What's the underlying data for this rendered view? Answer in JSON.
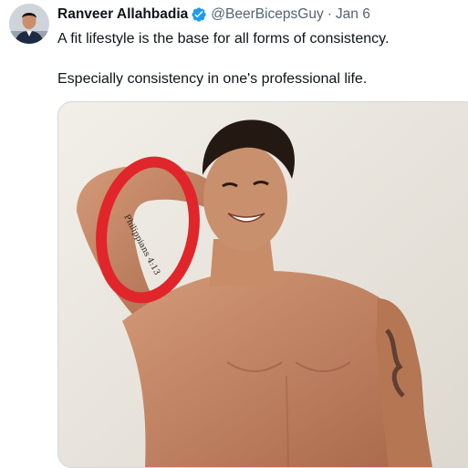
{
  "tweet": {
    "author": {
      "display_name": "Ranveer Allahbadia",
      "handle": "@BeerBicepsGuy",
      "verified": true,
      "avatar_icon": "profile-photo"
    },
    "separator": "·",
    "date": "Jan 6",
    "text_lines": [
      "A fit lifestyle is the base for all forms of consistency.",
      "Especially consistency in one's professional life."
    ],
    "media": {
      "tattoo_text": "Philippians 4:13",
      "annotation_color": "#e0262b"
    }
  },
  "colors": {
    "verified_badge": "#1d9bf0",
    "secondary_text": "#536471",
    "primary_text": "#0f1419",
    "border": "#cfd9de"
  }
}
